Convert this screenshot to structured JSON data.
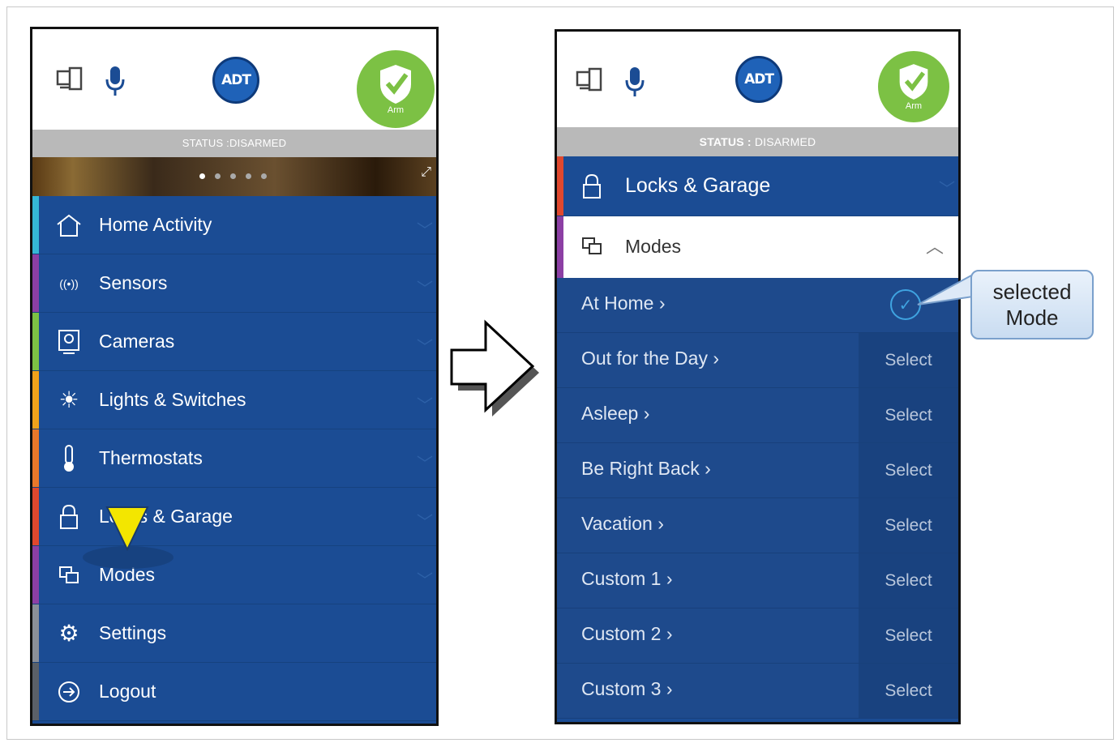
{
  "left_screen": {
    "status_label": "STATUS :",
    "status_value": "DISARMED",
    "arm_label": "Arm",
    "logo_text": "ADT",
    "menu": [
      {
        "label": "Home Activity",
        "icon": "house-icon",
        "color": "#35b7d6"
      },
      {
        "label": "Sensors",
        "icon": "sensor-icon",
        "color": "#8c3fa4"
      },
      {
        "label": "Cameras",
        "icon": "camera-icon",
        "color": "#7cc144"
      },
      {
        "label": "Lights & Switches",
        "icon": "light-icon",
        "color": "#f0a21b"
      },
      {
        "label": "Thermostats",
        "icon": "thermometer-icon",
        "color": "#e9782a"
      },
      {
        "label": "Locks & Garage",
        "icon": "lock-icon",
        "color": "#e0482e"
      },
      {
        "label": "Modes",
        "icon": "modes-icon",
        "color": "#8c3fa4"
      },
      {
        "label": "Settings",
        "icon": "gear-icon",
        "color": "#8a8f98"
      },
      {
        "label": "Logout",
        "icon": "logout-icon",
        "color": "#5a6068"
      }
    ]
  },
  "right_screen": {
    "status_label": "STATUS :",
    "status_value": "DISARMED",
    "arm_label": "Arm",
    "logo_text": "ADT",
    "locks_label": "Locks & Garage",
    "modes_label": "Modes",
    "modes": [
      {
        "label": "At Home",
        "selected": true
      },
      {
        "label": "Out for the Day",
        "action": "Select"
      },
      {
        "label": "Asleep",
        "action": "Select"
      },
      {
        "label": "Be Right Back",
        "action": "Select"
      },
      {
        "label": "Vacation",
        "action": "Select"
      },
      {
        "label": "Custom 1",
        "action": "Select"
      },
      {
        "label": "Custom 2",
        "action": "Select"
      },
      {
        "label": "Custom 3",
        "action": "Select"
      }
    ]
  },
  "callout": {
    "line1": "selected",
    "line2": "Mode"
  }
}
